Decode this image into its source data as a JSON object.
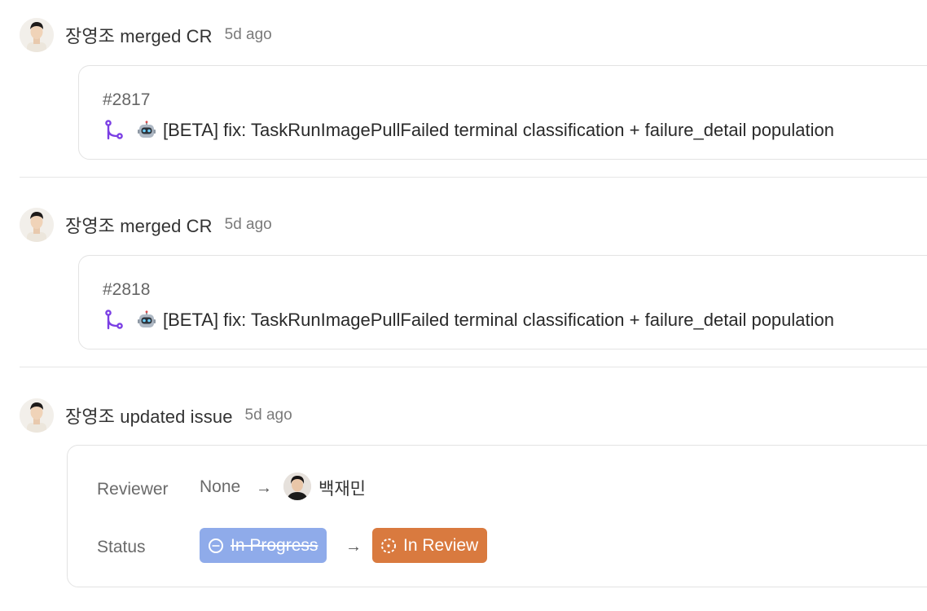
{
  "activities": [
    {
      "actor": "장영조",
      "action": "merged CR",
      "time": "5d ago",
      "cr": {
        "number": "#2817",
        "title": "[BETA] fix: TaskRunImagePullFailed terminal classification + failure_detail population"
      }
    },
    {
      "actor": "장영조",
      "action": "merged CR",
      "time": "5d ago",
      "cr": {
        "number": "#2818",
        "title": "[BETA] fix: TaskRunImagePullFailed terminal classification + failure_detail population"
      }
    },
    {
      "actor": "장영조",
      "action": "updated issue",
      "time": "5d ago",
      "changes": {
        "reviewer": {
          "label": "Reviewer",
          "from": "None",
          "to": "백재민"
        },
        "status": {
          "label": "Status",
          "from": "In Progress",
          "to": "In Review"
        }
      }
    }
  ],
  "icons": {
    "merge": "git-merge-icon",
    "robot": "robot-emoji-icon",
    "arrow": "arrow-right-icon",
    "status_in_progress": "dotted-circle-icon",
    "status_in_review": "dashed-circle-icon"
  },
  "colors": {
    "merge_icon": "#7b3fe4",
    "status_in_progress": "#8fabea",
    "status_in_review": "#d97a3f"
  }
}
